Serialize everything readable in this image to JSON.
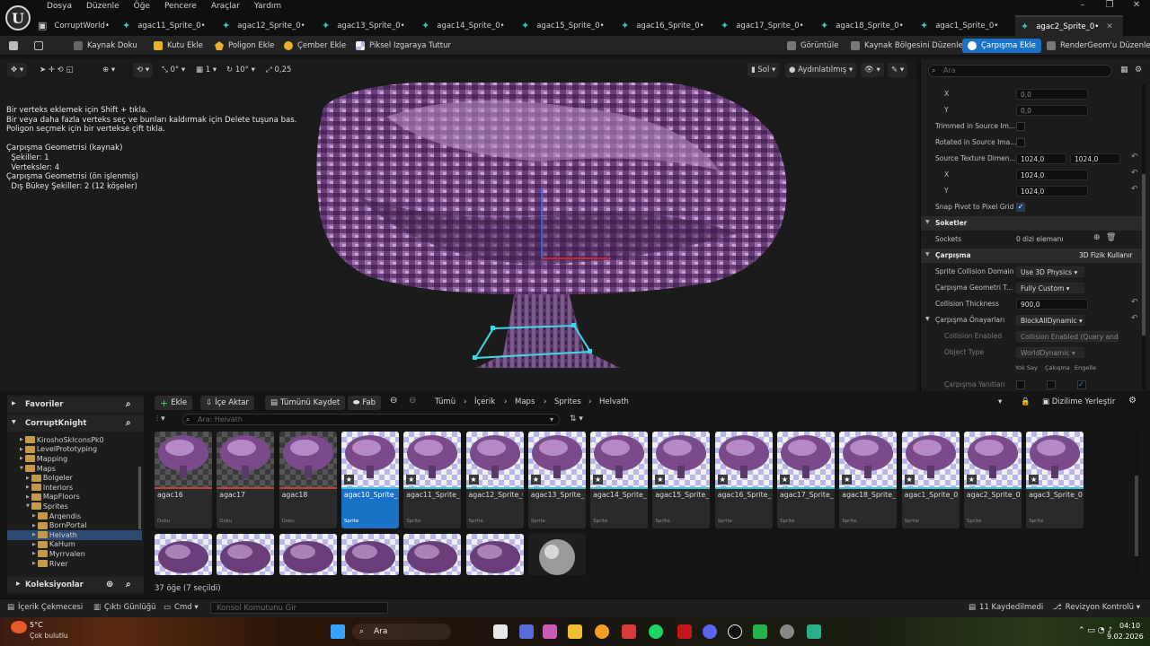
{
  "menu": [
    "Dosya",
    "Düzenle",
    "Öğe",
    "Pencere",
    "Araçlar",
    "Yardım"
  ],
  "tabs": [
    "CorruptWorld•",
    "agac11_Sprite_0•",
    "agac12_Sprite_0•",
    "agac13_Sprite_0•",
    "agac14_Sprite_0•",
    "agac15_Sprite_0•",
    "agac16_Sprite_0•",
    "agac17_Sprite_0•",
    "agac18_Sprite_0•",
    "agac1_Sprite_0•",
    "agac2_Sprite_0•"
  ],
  "active_tab": "agac2_Sprite_0•",
  "toolbar": {
    "source_texture": "Kaynak Doku",
    "add_box": "Kutu Ekle",
    "add_polygon": "Poligon Ekle",
    "add_circle": "Çember Ekle",
    "snap_pixel": "Piksel Izgaraya Tuttur",
    "view": "Görüntüle",
    "edit_source_region": "Kaynak Bölgesini Düzenle",
    "add_collision": "Çarpışma Ekle",
    "edit_rendergeom": "RenderGeom'u Düzenle"
  },
  "viewport_bar": {
    "rot_val": "0°",
    "scale_val": "1",
    "angle_val": "10°",
    "cam_speed": "0,25",
    "view_side": "Sol",
    "lighting": "Aydınlatılmış"
  },
  "viewport_text": [
    "Bir verteks eklemek için Shift + tıkla.",
    "Bir veya daha fazla verteks seç ve bunları kaldırmak için Delete tuşuna bas.",
    "Poligon seçmek için bir vertekse çift tıkla.",
    "",
    "Çarpışma Geometrisi (kaynak)",
    "  Şekiller: 1",
    "  Verteksler: 4",
    "Çarpışma Geometrisi (ön işlenmiş)",
    "  Dış Bükey Şekiller: 2 (12 köşeler)"
  ],
  "details": {
    "search_placeholder": "Ara",
    "x_label": "X",
    "y_label": "Y",
    "x_value": "0,0",
    "y_value": "0,0",
    "trimmed": "Trimmed in Source Im...",
    "rotated": "Rotated in Source Ima...",
    "source_texture_dim": "Source Texture Dimen...",
    "dim_x": "1024,0",
    "dim_y": "1024,0",
    "snap_pivot": "Snap Pivot to Pixel Grid",
    "sockets_section": "Soketler",
    "sockets_label": "Sockets",
    "sockets_value": "0 dizi elemanı",
    "collision_section": "Çarpışma",
    "collision_3d": "3D Fizik Kullanır",
    "sprite_collision_domain": "Sprite Collision Domain",
    "sprite_collision_domain_val": "Use 3D Physics",
    "collision_geom_type": "Çarpışma Geometri T...",
    "collision_geom_type_val": "Fully Custom",
    "collision_thickness": "Collision Thickness",
    "collision_thickness_val": "900,0",
    "collision_presets": "Çarpışma Önayarları",
    "collision_presets_val": "BlockAllDynamic",
    "collision_enabled": "Collision Enabled",
    "collision_enabled_val": "Collision Enabled (Query and",
    "object_type": "Object Type",
    "object_type_val": "WorldDynamic",
    "col_ignore": "Yok Say",
    "col_overlap": "Çakışma",
    "col_block": "Engelle",
    "collision_responses": "Çarpışma Yanıtları"
  },
  "content_browser": {
    "favorites": "Favoriler",
    "project": "CorruptKnight",
    "collections": "Koleksiyonlar",
    "tree": [
      {
        "label": "KiroshoSkIconsPk0",
        "depth": 1
      },
      {
        "label": "LevelPrototyping",
        "depth": 1
      },
      {
        "label": "Mapping",
        "depth": 1
      },
      {
        "label": "Maps",
        "depth": 1
      },
      {
        "label": "Bolgeler",
        "depth": 2
      },
      {
        "label": "Interiors",
        "depth": 2
      },
      {
        "label": "MapFloors",
        "depth": 2
      },
      {
        "label": "Sprites",
        "depth": 2
      },
      {
        "label": "Arqendis",
        "depth": 3
      },
      {
        "label": "BornPortal",
        "depth": 3
      },
      {
        "label": "Helvath",
        "depth": 3
      },
      {
        "label": "KaHum",
        "depth": 3
      },
      {
        "label": "Myrrvalen",
        "depth": 3
      },
      {
        "label": "River",
        "depth": 3
      }
    ],
    "add": "Ekle",
    "import": "İçe Aktar",
    "save_all": "Tümünü Kaydet",
    "fab": "Fab",
    "breadcrumb": [
      "Tümü",
      "İçerik",
      "Maps",
      "Sprites",
      "Helvath"
    ],
    "search_placeholder": "Ara: Helvath",
    "dock": "Dizilime Yerleştir",
    "count": "37 öğe (7 seçildi)",
    "assets_row1": [
      {
        "name": "agac16",
        "type": "Doku",
        "kind": "texture"
      },
      {
        "name": "agac17",
        "type": "Doku",
        "kind": "texture"
      },
      {
        "name": "agac18",
        "type": "Doku",
        "kind": "texture"
      },
      {
        "name": "agac10_Sprite_0",
        "type": "Sprite",
        "kind": "sprite",
        "selected": true
      },
      {
        "name": "agac11_Sprite_0",
        "type": "Sprite",
        "kind": "sprite"
      },
      {
        "name": "agac12_Sprite_0",
        "type": "Sprite",
        "kind": "sprite"
      },
      {
        "name": "agac13_Sprite_0",
        "type": "Sprite",
        "kind": "sprite"
      },
      {
        "name": "agac14_Sprite_0",
        "type": "Sprite",
        "kind": "sprite"
      },
      {
        "name": "agac15_Sprite_0",
        "type": "Sprite",
        "kind": "sprite"
      },
      {
        "name": "agac16_Sprite_0",
        "type": "Sprite",
        "kind": "sprite"
      },
      {
        "name": "agac17_Sprite_0",
        "type": "Sprite",
        "kind": "sprite"
      },
      {
        "name": "agac18_Sprite_0",
        "type": "Sprite",
        "kind": "sprite"
      },
      {
        "name": "agac1_Sprite_0",
        "type": "Sprite",
        "kind": "sprite"
      },
      {
        "name": "agac2_Sprite_0",
        "type": "Sprite",
        "kind": "sprite"
      },
      {
        "name": "agac3_Sprite_0",
        "type": "Sprite",
        "kind": "sprite"
      }
    ]
  },
  "status": {
    "content_drawer": "İçerik Çekmecesi",
    "output_log": "Çıktı Günlüğü",
    "cmd": "Cmd",
    "console_placeholder": "Konsol Komutunu Gir",
    "unsaved": "11 Kaydedilmedi",
    "revision": "Revizyon Kontrolü"
  },
  "taskbar": {
    "temp": "5°C",
    "weather": "Çok bulutlu",
    "search": "Ara",
    "time": "04:10",
    "date": "9.02.2026"
  },
  "colors": {
    "accent": "#1a72c8",
    "tab_icon": "#3ec4b3",
    "collision": "#3fd8e8",
    "tree": "#8a5a9a"
  }
}
